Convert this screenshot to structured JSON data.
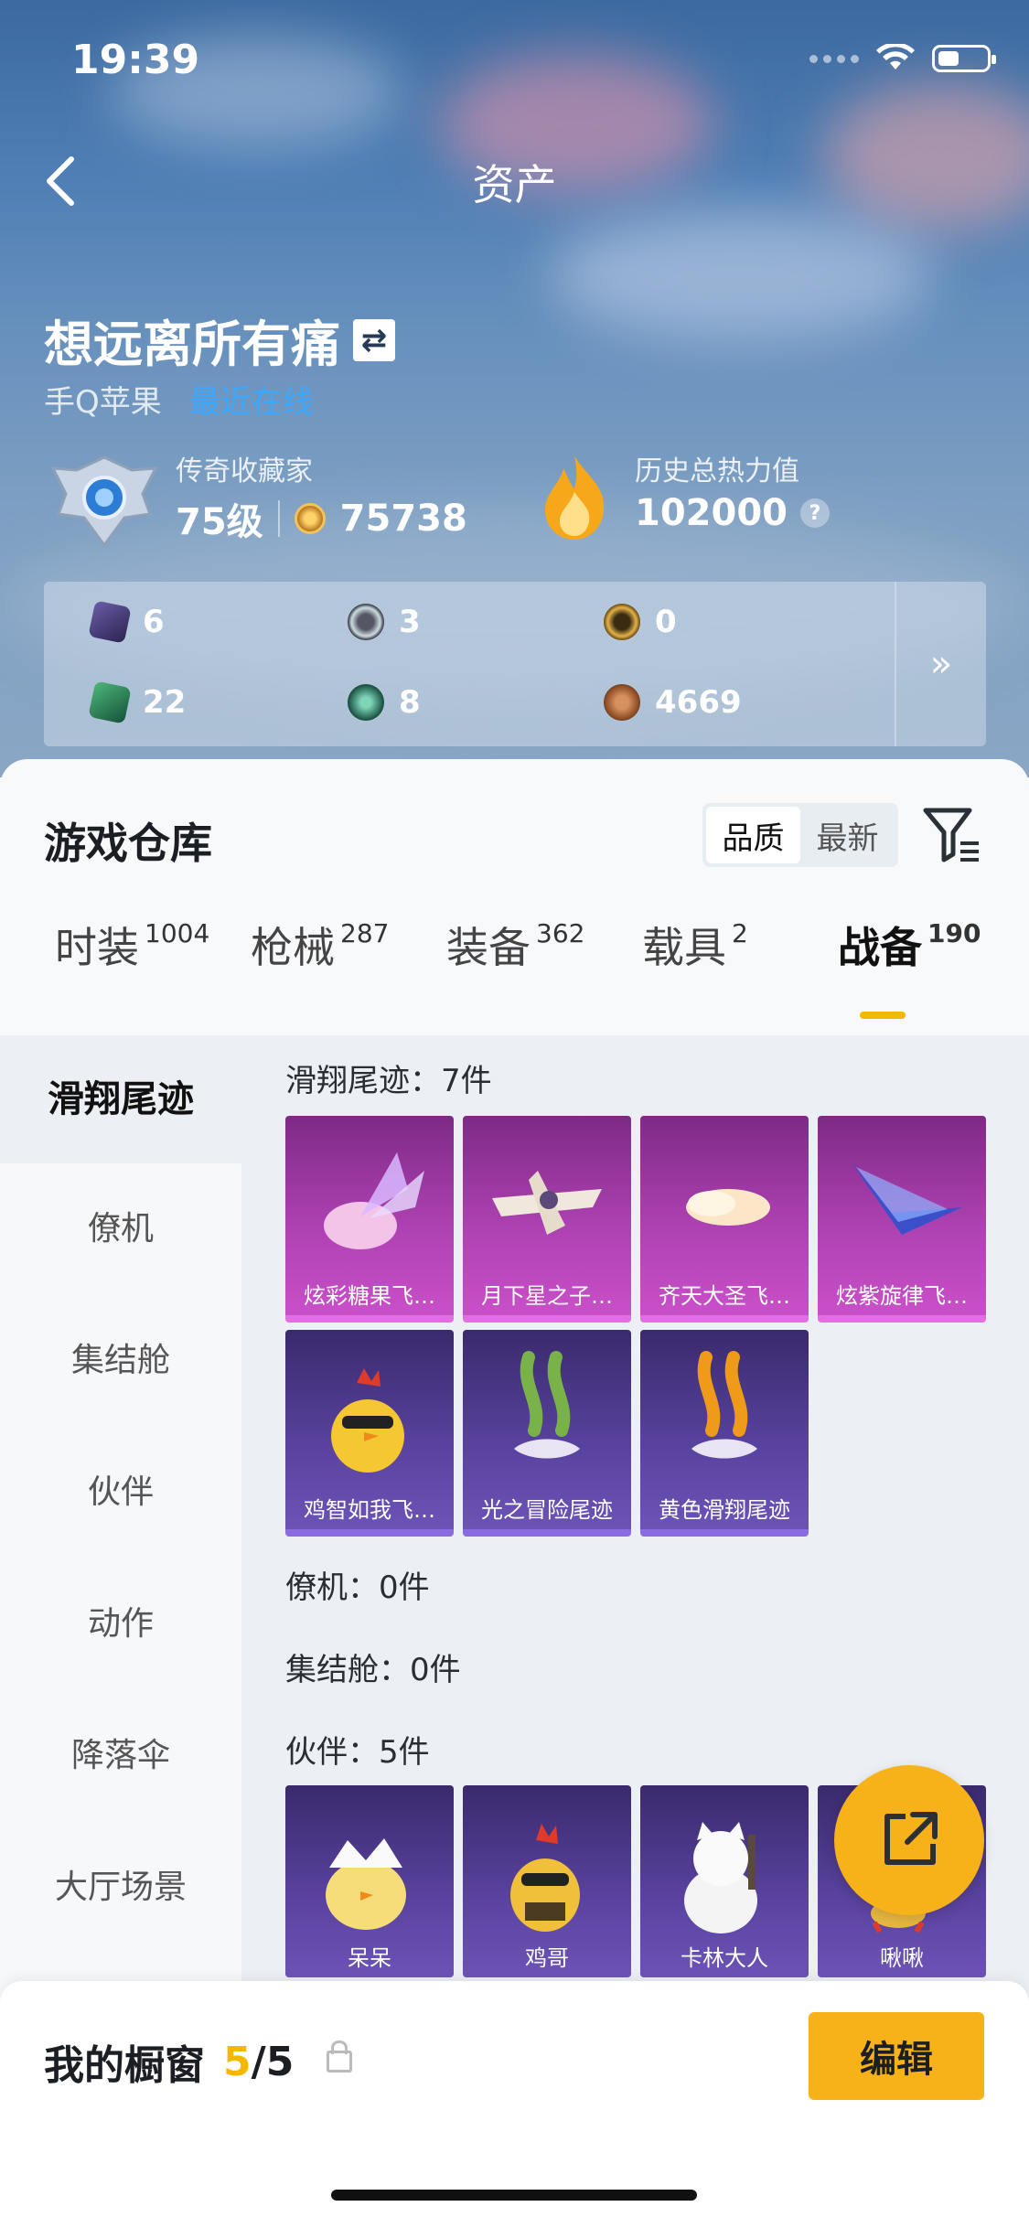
{
  "status_bar": {
    "time": "19:39"
  },
  "header": {
    "title": "资产"
  },
  "profile": {
    "username": "想远离所有痛",
    "swap_icon": "⇄",
    "platform": "手Q苹果",
    "online_status": "最近在线"
  },
  "stats": {
    "rank_title": "传奇收藏家",
    "level": "75级",
    "collection_score": "75738",
    "history_title": "历史总热力值",
    "history_value": "102000",
    "help_icon": "?"
  },
  "currencies": [
    {
      "icon": "purple-card-icon",
      "value": "6"
    },
    {
      "icon": "silver-token-icon",
      "value": "3"
    },
    {
      "icon": "gold-token-icon",
      "value": "0"
    },
    {
      "icon": "green-card-icon",
      "value": "22"
    },
    {
      "icon": "green-orb-icon",
      "value": "8"
    },
    {
      "icon": "bronze-coin-icon",
      "value": "4669"
    }
  ],
  "currency_more": "»",
  "warehouse": {
    "title": "游戏仓库",
    "sort_options": [
      "品质",
      "最新"
    ],
    "active_sort": "品质"
  },
  "tabs": [
    {
      "label": "时装",
      "count": "1004"
    },
    {
      "label": "枪械",
      "count": "287"
    },
    {
      "label": "装备",
      "count": "362"
    },
    {
      "label": "载具",
      "count": "2"
    },
    {
      "label": "战备",
      "count": "190"
    }
  ],
  "active_tab": "战备",
  "sidebar": [
    {
      "label": "滑翔尾迹"
    },
    {
      "label": "僚机"
    },
    {
      "label": "集结舱"
    },
    {
      "label": "伙伴"
    },
    {
      "label": "动作"
    },
    {
      "label": "降落伞"
    },
    {
      "label": "大厅场景"
    }
  ],
  "sections": {
    "trail_label": "滑翔尾迹：7件",
    "wingman_label": "僚机：0件",
    "capsule_label": "集结舱：0件",
    "partner_label": "伙伴：5件"
  },
  "trail_items": [
    {
      "name": "炫彩糖果飞…",
      "rarity": "legendary"
    },
    {
      "name": "月下星之子…",
      "rarity": "legendary"
    },
    {
      "name": "齐天大圣飞…",
      "rarity": "legendary"
    },
    {
      "name": "炫紫旋律飞…",
      "rarity": "legendary"
    },
    {
      "name": "鸡智如我飞…",
      "rarity": "epic"
    },
    {
      "name": "光之冒险尾迹",
      "rarity": "epic"
    },
    {
      "name": "黄色滑翔尾迹",
      "rarity": "epic"
    }
  ],
  "partner_items": [
    {
      "name": "呆呆"
    },
    {
      "name": "鸡哥"
    },
    {
      "name": "卡林大人"
    },
    {
      "name": "啾啾"
    }
  ],
  "showcase": {
    "label": "我的橱窗",
    "current": "5",
    "total": "/5",
    "edit_label": "编辑"
  },
  "colors": {
    "accent": "#f7b21a",
    "online": "#3aa8ff",
    "legendary": "#b143b5",
    "epic": "#5a43a0"
  }
}
